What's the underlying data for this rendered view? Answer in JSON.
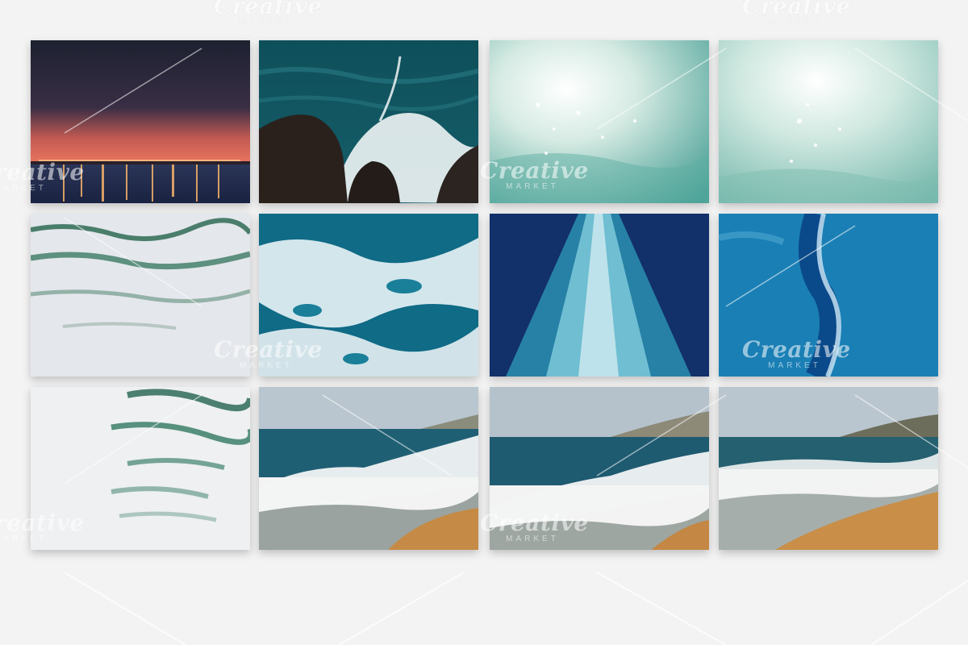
{
  "watermark": {
    "brand": "Creative",
    "sub": "MARKET"
  },
  "tiles": [
    {
      "id": "night-harbor"
    },
    {
      "id": "wave-splash-rocks"
    },
    {
      "id": "sunlit-water-1"
    },
    {
      "id": "sunlit-water-2"
    },
    {
      "id": "calm-ripples"
    },
    {
      "id": "sea-foam"
    },
    {
      "id": "boat-wake"
    },
    {
      "id": "blue-reflection"
    },
    {
      "id": "green-ripples"
    },
    {
      "id": "beach-wave-1"
    },
    {
      "id": "beach-wave-2"
    },
    {
      "id": "beach-wave-3"
    }
  ]
}
